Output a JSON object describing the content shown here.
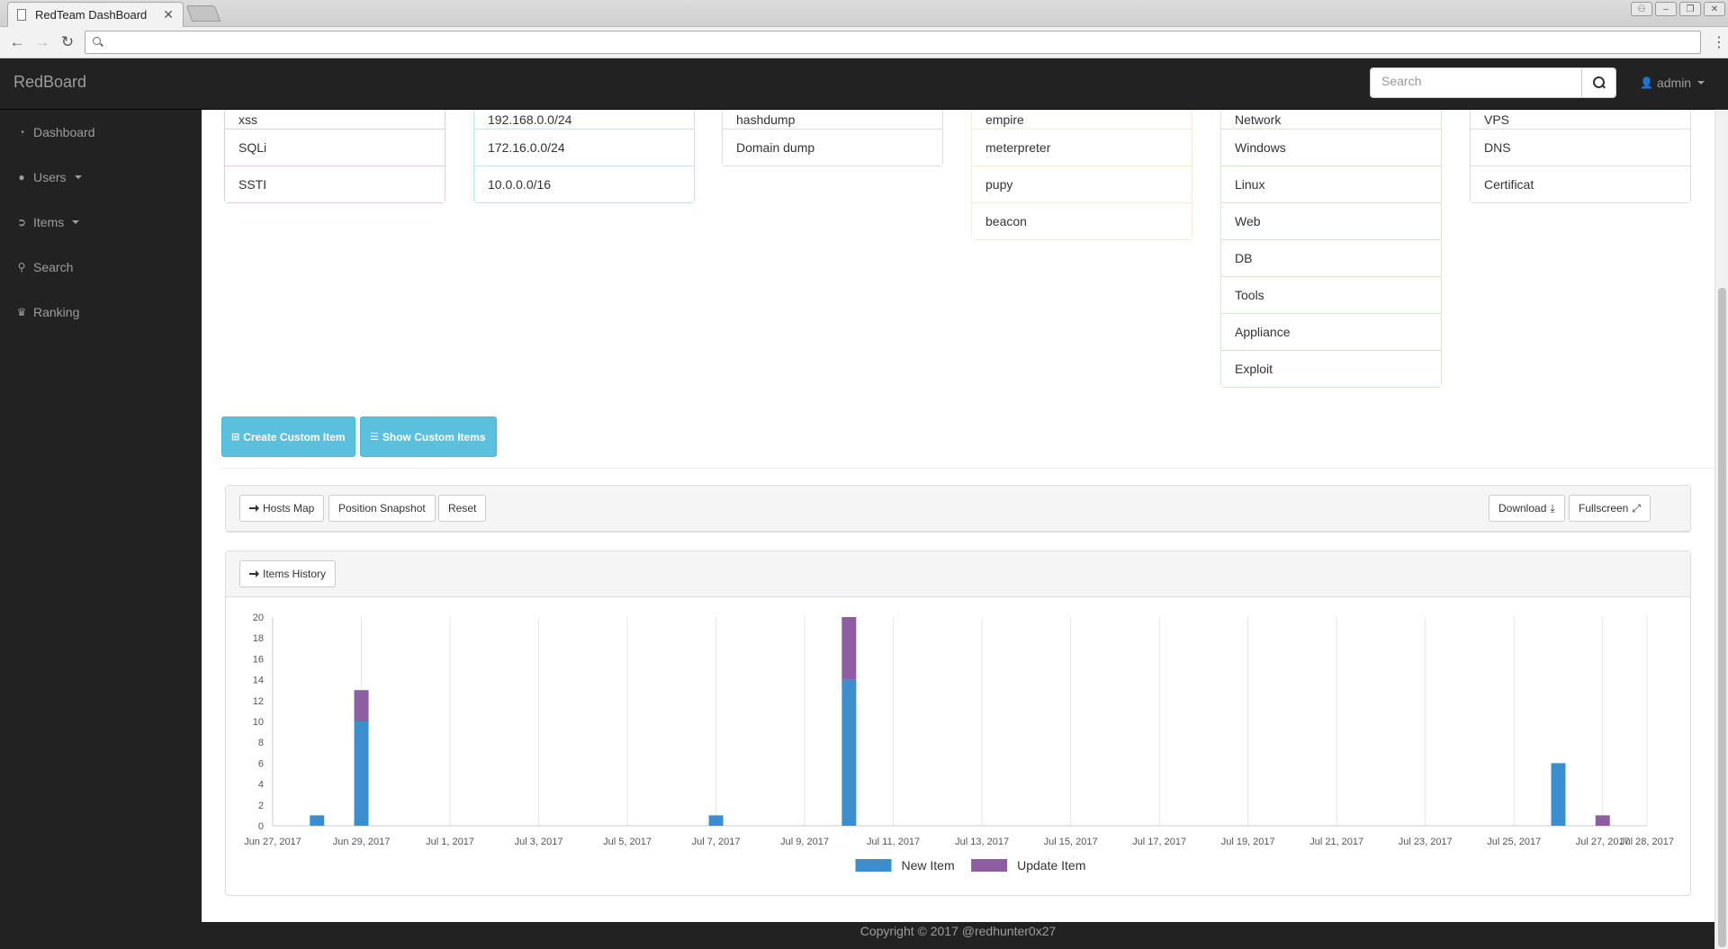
{
  "browser": {
    "tab_title": "RedTeam DashBoard",
    "tab_close": "✕"
  },
  "app": {
    "brand": "RedBoard",
    "search_placeholder": "Search",
    "user": "admin"
  },
  "sidebar": {
    "items": [
      {
        "label": "Dashboard",
        "icon": "dashboard-icon"
      },
      {
        "label": "Users",
        "icon": "user-icon"
      },
      {
        "label": "Items",
        "icon": "circle-arrow-icon"
      },
      {
        "label": "Search",
        "icon": "search-icon"
      },
      {
        "label": "Ranking",
        "icon": "trophy-icon"
      }
    ]
  },
  "lists": [
    {
      "items": [
        "xss",
        "SQLi",
        "SSTI"
      ],
      "color": "#ebccd1"
    },
    {
      "items": [
        "192.168.0.0/24",
        "172.16.0.0/24",
        "10.0.0.0/16"
      ],
      "color": "#bce8f1"
    },
    {
      "items": [
        "hashdump",
        "Domain dump"
      ],
      "color": "#dddddd"
    },
    {
      "items": [
        "empire",
        "meterpreter",
        "pupy",
        "beacon"
      ],
      "color": "#faebcc"
    },
    {
      "items": [
        "Network",
        "Windows",
        "Linux",
        "Web",
        "DB",
        "Tools",
        "Appliance",
        "Exploit"
      ],
      "color": "#d6e9c6"
    },
    {
      "items": [
        "VPS",
        "DNS",
        "Certificat"
      ],
      "color": "#dddddd"
    }
  ],
  "buttons": {
    "create_custom": "Create Custom Item",
    "show_custom": "Show Custom Items",
    "hosts_map": "Hosts Map",
    "position_snapshot": "Position Snapshot",
    "reset": "Reset",
    "download": "Download",
    "fullscreen": "Fullscreen",
    "items_history": "Items History"
  },
  "footer": "Copyright © 2017 @redhunter0x27",
  "chart_data": {
    "type": "bar",
    "stacked": true,
    "x_ticks": [
      "Jun 27, 2017",
      "Jun 29, 2017",
      "Jul 1, 2017",
      "Jul 3, 2017",
      "Jul 5, 2017",
      "Jul 7, 2017",
      "Jul 9, 2017",
      "Jul 11, 2017",
      "Jul 13, 2017",
      "Jul 15, 2017",
      "Jul 17, 2017",
      "Jul 19, 2017",
      "Jul 21, 2017",
      "Jul 23, 2017",
      "Jul 25, 2017",
      "Jul 27, 2017",
      "Jul 28, 2017"
    ],
    "ylim": [
      0,
      20
    ],
    "y_ticks": [
      0,
      2,
      4,
      6,
      8,
      10,
      12,
      14,
      16,
      18,
      20
    ],
    "grid": true,
    "legend_position": "bottom-center",
    "series": [
      {
        "name": "New Item",
        "color": "#3b8fd0",
        "points": [
          [
            "Jun 28, 2017",
            1
          ],
          [
            "Jun 29, 2017",
            10
          ],
          [
            "Jul 7, 2017",
            1
          ],
          [
            "Jul 10, 2017",
            14
          ],
          [
            "Jul 26, 2017",
            6
          ]
        ]
      },
      {
        "name": "Update Item",
        "color": "#8e5ea2",
        "points": [
          [
            "Jun 29, 2017",
            3
          ],
          [
            "Jul 10, 2017",
            6
          ],
          [
            "Jul 27, 2017",
            1
          ]
        ]
      }
    ]
  }
}
